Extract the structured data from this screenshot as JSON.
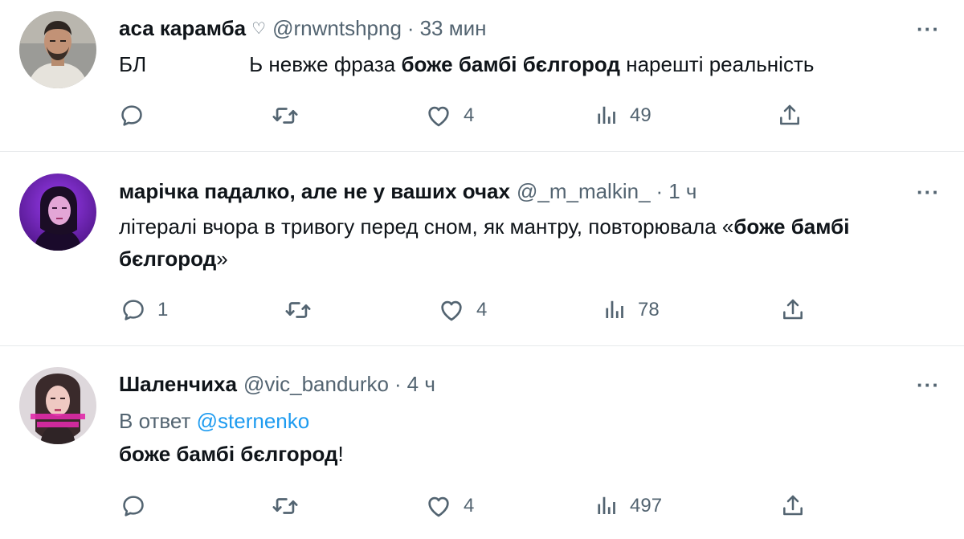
{
  "tweets": [
    {
      "name": "аса карамба",
      "name_icon": "heart-outline-icon",
      "handle": "@rnwntshpng",
      "separator": "·",
      "time": "33 мин",
      "text_pre": "БЛ",
      "text_mid": "Ь невже фраза ",
      "text_bold": "боже бамбі бєлгород",
      "text_post": " нарешті реальність",
      "counts": {
        "reply": "",
        "retweet": "",
        "like": "4",
        "views": "49"
      }
    },
    {
      "name": "марічка падалко, але не у ваших очах",
      "handle": "@_m_malkin_",
      "separator": "·",
      "time": "1 ч",
      "text_pre": "літералі вчора в тривогу перед сном, як мантру, повторювала «",
      "text_bold": "боже бамбі бєлгород",
      "text_post": "»",
      "counts": {
        "reply": "1",
        "retweet": "",
        "like": "4",
        "views": "78"
      }
    },
    {
      "name": "Шаленчиха",
      "handle": "@vic_bandurko",
      "separator": "·",
      "time": "4 ч",
      "reply_prefix": "В ответ ",
      "reply_mention": "@sternenko",
      "text_bold": "боже бамбі бєлгород",
      "text_post": "!",
      "counts": {
        "reply": "",
        "retweet": "",
        "like": "4",
        "views": "497"
      }
    }
  ],
  "more_label": "···",
  "icons": {
    "reply": "reply-icon",
    "retweet": "retweet-icon",
    "like": "like-icon",
    "views": "views-icon",
    "share": "share-icon"
  },
  "colors": {
    "text": "#0f1419",
    "secondary": "#536471",
    "link": "#1d9bf0",
    "divider": "#e6e9eb"
  }
}
